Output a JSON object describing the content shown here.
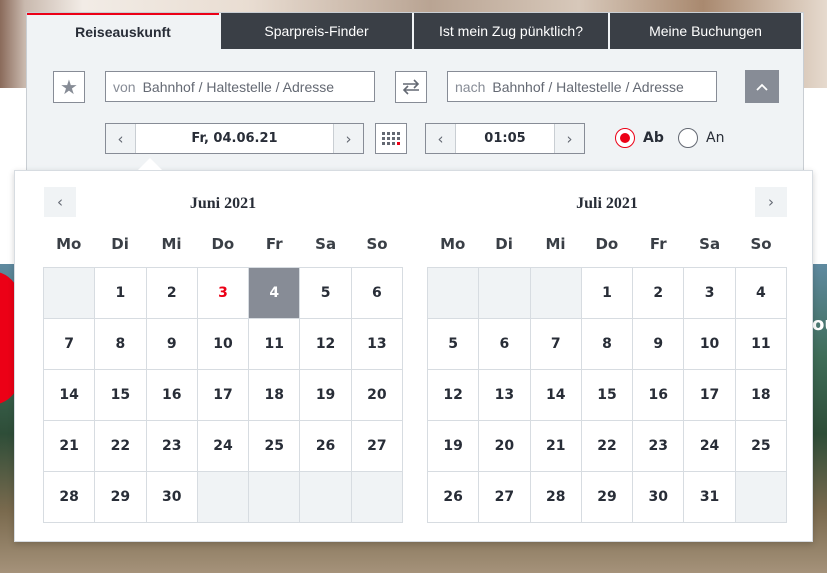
{
  "tabs": [
    {
      "label": "Reiseauskunft",
      "active": true
    },
    {
      "label": "Sparpreis-Finder",
      "active": false
    },
    {
      "label": "Ist mein Zug pünktlich?",
      "active": false
    },
    {
      "label": "Meine Buchungen",
      "active": false
    }
  ],
  "from": {
    "prefix": "von",
    "placeholder": "Bahnhof / Haltestelle / Adresse"
  },
  "to": {
    "prefix": "nach",
    "placeholder": "Bahnhof / Haltestelle / Adresse"
  },
  "date": {
    "value": "Fr, 04.06.21"
  },
  "time": {
    "value": "01:05"
  },
  "mode": {
    "ab_label": "Ab",
    "an_label": "An",
    "selected": "Ab"
  },
  "icons": {
    "favorite": "star-icon",
    "swap": "swap-arrows-icon",
    "collapse": "chevron-up-icon",
    "calendar": "calendar-grid-icon",
    "prev": "chevron-left-icon",
    "next": "chevron-right-icon"
  },
  "colors": {
    "accent": "#ec0016",
    "selected_day": "#878c96",
    "tab_dark": "#3a3f46"
  },
  "calendar": {
    "weekdays": [
      "Mo",
      "Di",
      "Mi",
      "Do",
      "Fr",
      "Sa",
      "So"
    ],
    "months": [
      {
        "title": "Juni 2021",
        "days": [
          "",
          "1",
          "2",
          "3",
          "4",
          "5",
          "6",
          "7",
          "8",
          "9",
          "10",
          "11",
          "12",
          "13",
          "14",
          "15",
          "16",
          "17",
          "18",
          "19",
          "20",
          "21",
          "22",
          "23",
          "24",
          "25",
          "26",
          "27",
          "28",
          "29",
          "30",
          "",
          "",
          "",
          ""
        ],
        "today": "3",
        "selected": "4"
      },
      {
        "title": "Juli 2021",
        "days": [
          "",
          "",
          "",
          "1",
          "2",
          "3",
          "4",
          "5",
          "6",
          "7",
          "8",
          "9",
          "10",
          "11",
          "12",
          "13",
          "14",
          "15",
          "16",
          "17",
          "18",
          "19",
          "20",
          "21",
          "22",
          "23",
          "24",
          "25",
          "26",
          "27",
          "28",
          "29",
          "30",
          "31",
          ""
        ],
        "today": "",
        "selected": ""
      }
    ]
  }
}
